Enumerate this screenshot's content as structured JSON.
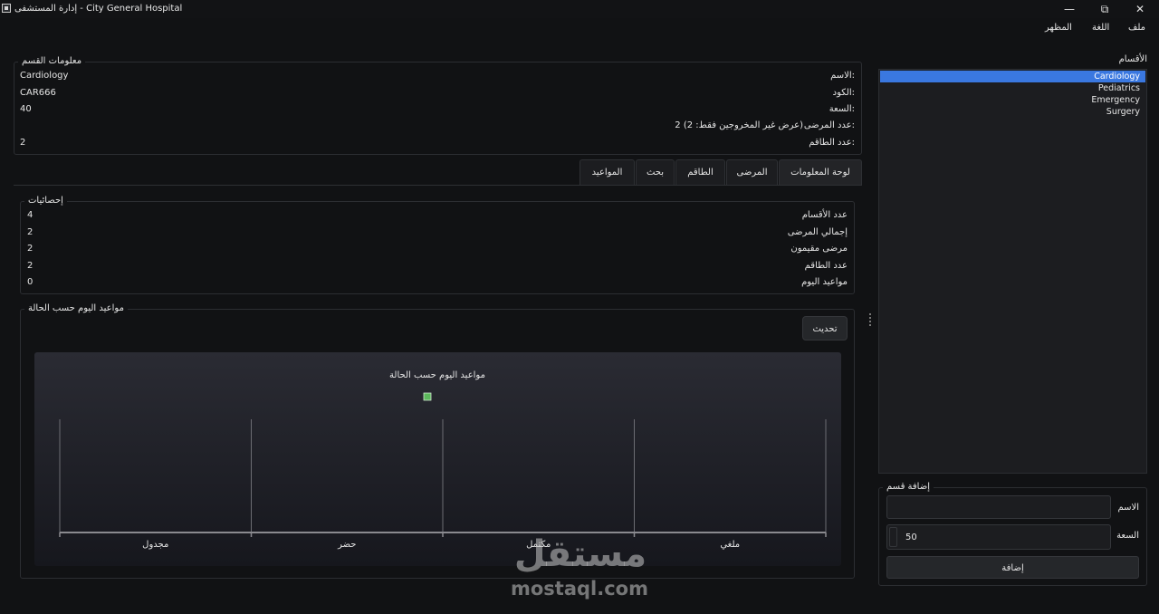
{
  "window": {
    "title": "إدارة المستشفى - City General Hospital",
    "minimize_icon": "minimize-icon",
    "restore_icon": "restore-icon",
    "close_icon": "close-icon"
  },
  "menu": {
    "file": "ملف",
    "language": "اللغة",
    "appearance": "المظهر"
  },
  "department_info": {
    "title": "معلومات القسم",
    "name_label": "الاسم:",
    "name_value": "Cardiology",
    "code_label": "الكود:",
    "code_value": "CAR666",
    "capacity_label": "السعة:",
    "capacity_value": "40",
    "patients_label": "عدد المرضى:",
    "patients_value": "2 (عرض غير المخروجين فقط: 2)",
    "staff_label": "عدد الطاقم:",
    "staff_value": "2"
  },
  "tabs": [
    {
      "label": "لوحة المعلومات",
      "active": true
    },
    {
      "label": "المرضى",
      "active": false
    },
    {
      "label": "الطاقم",
      "active": false
    },
    {
      "label": "بحث",
      "active": false
    },
    {
      "label": "المواعيد",
      "active": false
    }
  ],
  "stats": {
    "title": "إحصائيات",
    "rows": [
      {
        "label": "عدد الأقسام",
        "value": "4"
      },
      {
        "label": "إجمالي المرضى",
        "value": "2"
      },
      {
        "label": "مرضى مقيمون",
        "value": "2"
      },
      {
        "label": "عدد الطاقم",
        "value": "2"
      },
      {
        "label": "مواعيد اليوم",
        "value": "0"
      }
    ]
  },
  "appointments_panel": {
    "title": "مواعيد اليوم حسب الحالة",
    "refresh_label": "تحديث"
  },
  "chart_data": {
    "type": "bar",
    "title": "مواعيد اليوم حسب الحالة",
    "categories": [
      "مجدول",
      "حضر",
      "مكتمل",
      "ملغي"
    ],
    "series": [
      {
        "values": [
          0,
          0,
          0,
          0
        ],
        "color": "#5cb85c"
      }
    ],
    "legend": "top",
    "grid": true
  },
  "sidebar": {
    "title": "الأقسام",
    "departments": [
      "Cardiology",
      "Pediatrics",
      "Emergency",
      "Surgery"
    ],
    "selected": "Cardiology"
  },
  "add_department": {
    "title": "إضافة قسم",
    "name_label": "الاسم",
    "name_value": "",
    "capacity_label": "السعة",
    "capacity_value": "50",
    "add_label": "إضافة"
  },
  "watermark": {
    "logo": "مستقل",
    "url": "mostaql.com"
  },
  "colors": {
    "accent": "#3a78e0",
    "legend_marker": "#5cb85c",
    "background": "#111214"
  }
}
